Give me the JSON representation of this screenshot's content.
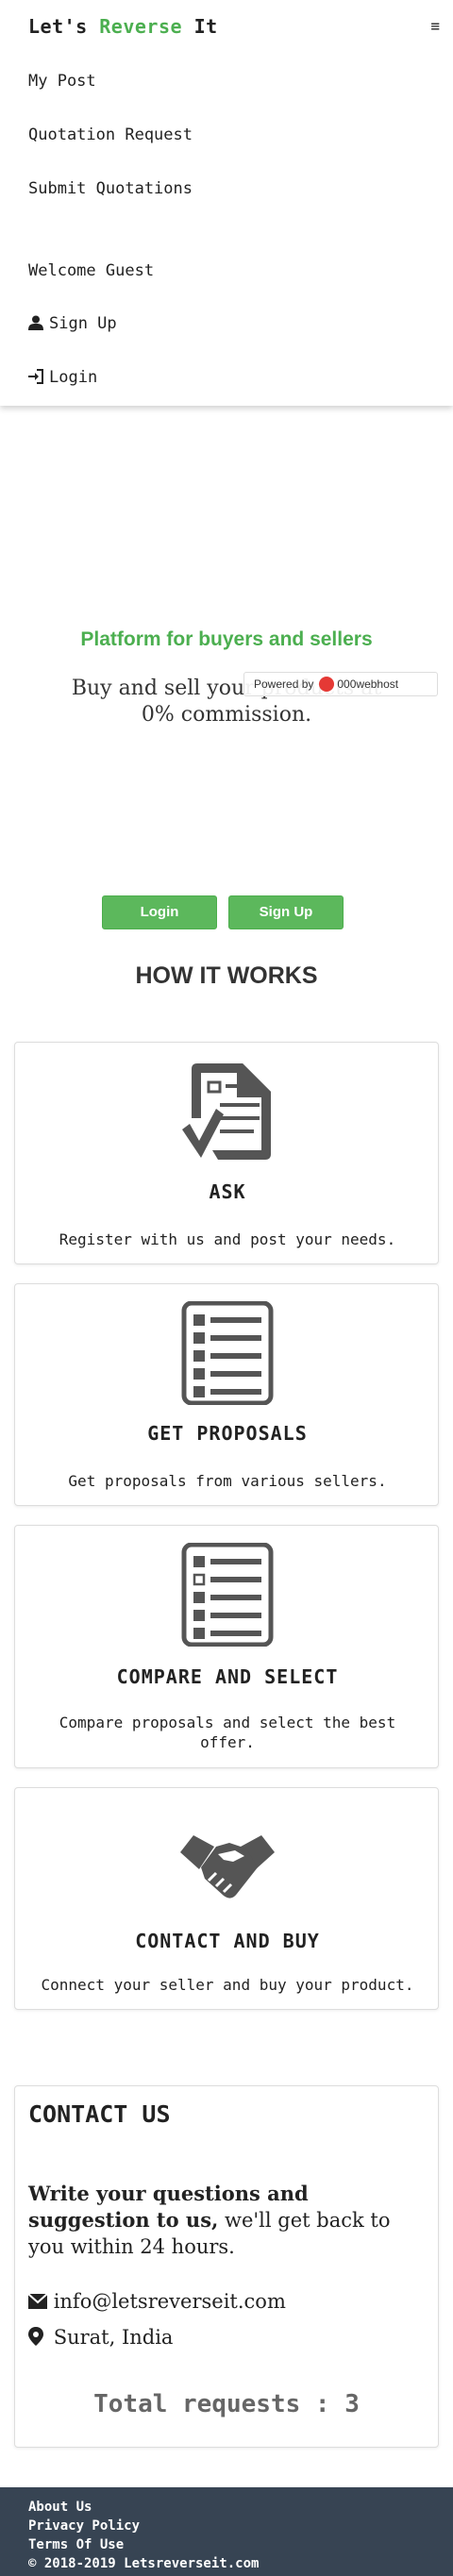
{
  "brand": {
    "part1": "Let's ",
    "part2": "Reverse",
    "part3": " It",
    "accent": "#4caf50"
  },
  "menu_glyph": "≡",
  "nav": {
    "items": [
      "My Post",
      "Quotation Request",
      "Submit Quotations"
    ],
    "welcome": "Welcome Guest",
    "signup": "Sign Up",
    "login": "Login"
  },
  "hero": {
    "title": "Platform for buyers and sellers",
    "subtitle": "Buy and sell your products at 0% commission.",
    "login_button": "Login",
    "signup_button": "Sign Up"
  },
  "badge": {
    "powered": "Powered by",
    "host": "000webhost"
  },
  "how_it_works": {
    "title": "HOW IT WORKS",
    "steps": [
      {
        "icon": "document-check-icon",
        "title": "ASK",
        "desc": "Register with us and post your needs."
      },
      {
        "icon": "list-icon",
        "title": "GET PROPOSALS",
        "desc": "Get proposals from various sellers."
      },
      {
        "icon": "list-select-icon",
        "title": "COMPARE AND SELECT",
        "desc": "Compare proposals and select the best offer."
      },
      {
        "icon": "handshake-icon",
        "title": "CONTACT AND BUY",
        "desc": "Connect your seller and buy your product."
      }
    ]
  },
  "contact": {
    "title": "CONTACT US",
    "bold_text": "Write your questions and suggestion to us,",
    "text": " we'll get back to you within 24 hours.",
    "email": "info@letsreverseit.com",
    "location": "Surat, India",
    "total": "Total requests : 3"
  },
  "footer": {
    "links": [
      "About Us",
      "Privacy Policy",
      "Terms Of Use"
    ],
    "copyright": "© 2018-2019 Letsreverseit.com"
  },
  "colors": {
    "green": "#4caf50",
    "button_green": "#5cb85c",
    "footer_bg": "#374453",
    "icon_gray": "#555555"
  }
}
